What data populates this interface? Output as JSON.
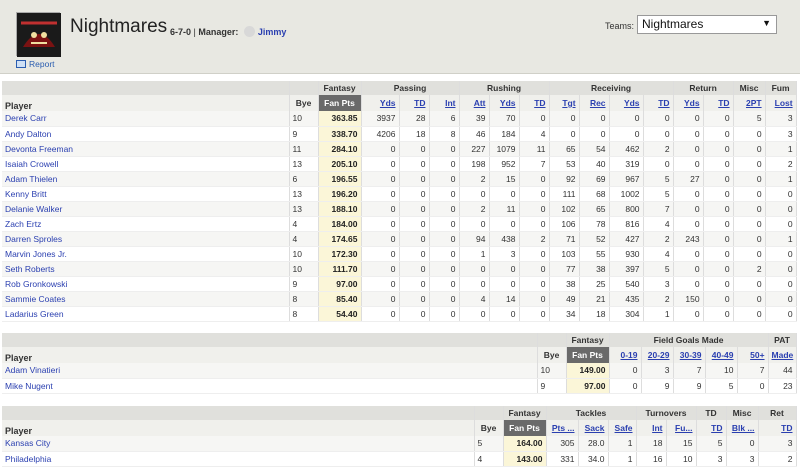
{
  "header": {
    "team_name": "Nightmares",
    "record": "6-7-0",
    "manager_label": "Manager:",
    "manager_name": "Jimmy",
    "report_label": "Report",
    "teams_label": "Teams:",
    "teams_selected": "Nightmares"
  },
  "offense": {
    "groups": {
      "fantasy": "Fantasy",
      "passing": "Passing",
      "rushing": "Rushing",
      "receiving": "Receiving",
      "return": "Return",
      "misc": "Misc",
      "fum": "Fum"
    },
    "cols": {
      "player": "Player",
      "bye": "Bye",
      "fanpts": "Fan Pts",
      "pass_yds": "Yds",
      "pass_td": "TD",
      "int": "Int",
      "att": "Att",
      "rush_yds": "Yds",
      "rush_td": "TD",
      "tgt": "Tgt",
      "rec": "Rec",
      "rec_yds": "Yds",
      "rec_td": "TD",
      "ret_yds": "Yds",
      "ret_td": "TD",
      "two_pt": "2PT",
      "lost": "Lost"
    },
    "rows": [
      {
        "name": "Derek Carr",
        "bye": "10",
        "fan": "363.85",
        "v": [
          "3937",
          "28",
          "6",
          "39",
          "70",
          "0",
          "0",
          "0",
          "0",
          "0",
          "0",
          "0",
          "5",
          "3"
        ]
      },
      {
        "name": "Andy Dalton",
        "bye": "9",
        "fan": "338.70",
        "v": [
          "4206",
          "18",
          "8",
          "46",
          "184",
          "4",
          "0",
          "0",
          "0",
          "0",
          "0",
          "0",
          "0",
          "3"
        ]
      },
      {
        "name": "Devonta Freeman",
        "bye": "11",
        "fan": "284.10",
        "v": [
          "0",
          "0",
          "0",
          "227",
          "1079",
          "11",
          "65",
          "54",
          "462",
          "2",
          "0",
          "0",
          "0",
          "1"
        ]
      },
      {
        "name": "Isaiah Crowell",
        "bye": "13",
        "fan": "205.10",
        "v": [
          "0",
          "0",
          "0",
          "198",
          "952",
          "7",
          "53",
          "40",
          "319",
          "0",
          "0",
          "0",
          "0",
          "2"
        ]
      },
      {
        "name": "Adam Thielen",
        "bye": "6",
        "fan": "196.55",
        "v": [
          "0",
          "0",
          "0",
          "2",
          "15",
          "0",
          "92",
          "69",
          "967",
          "5",
          "27",
          "0",
          "0",
          "1"
        ]
      },
      {
        "name": "Kenny Britt",
        "bye": "13",
        "fan": "196.20",
        "v": [
          "0",
          "0",
          "0",
          "0",
          "0",
          "0",
          "111",
          "68",
          "1002",
          "5",
          "0",
          "0",
          "0",
          "0"
        ]
      },
      {
        "name": "Delanie Walker",
        "bye": "13",
        "fan": "188.10",
        "v": [
          "0",
          "0",
          "0",
          "2",
          "11",
          "0",
          "102",
          "65",
          "800",
          "7",
          "0",
          "0",
          "0",
          "0"
        ]
      },
      {
        "name": "Zach Ertz",
        "bye": "4",
        "fan": "184.00",
        "v": [
          "0",
          "0",
          "0",
          "0",
          "0",
          "0",
          "106",
          "78",
          "816",
          "4",
          "0",
          "0",
          "0",
          "0"
        ]
      },
      {
        "name": "Darren Sproles",
        "bye": "4",
        "fan": "174.65",
        "v": [
          "0",
          "0",
          "0",
          "94",
          "438",
          "2",
          "71",
          "52",
          "427",
          "2",
          "243",
          "0",
          "0",
          "1"
        ]
      },
      {
        "name": "Marvin Jones Jr.",
        "bye": "10",
        "fan": "172.30",
        "v": [
          "0",
          "0",
          "0",
          "1",
          "3",
          "0",
          "103",
          "55",
          "930",
          "4",
          "0",
          "0",
          "0",
          "0"
        ]
      },
      {
        "name": "Seth Roberts",
        "bye": "10",
        "fan": "111.70",
        "v": [
          "0",
          "0",
          "0",
          "0",
          "0",
          "0",
          "77",
          "38",
          "397",
          "5",
          "0",
          "0",
          "2",
          "0"
        ]
      },
      {
        "name": "Rob Gronkowski",
        "bye": "9",
        "fan": "97.00",
        "v": [
          "0",
          "0",
          "0",
          "0",
          "0",
          "0",
          "38",
          "25",
          "540",
          "3",
          "0",
          "0",
          "0",
          "0"
        ]
      },
      {
        "name": "Sammie Coates",
        "bye": "8",
        "fan": "85.40",
        "v": [
          "0",
          "0",
          "0",
          "4",
          "14",
          "0",
          "49",
          "21",
          "435",
          "2",
          "150",
          "0",
          "0",
          "0"
        ]
      },
      {
        "name": "Ladarius Green",
        "bye": "8",
        "fan": "54.40",
        "v": [
          "0",
          "0",
          "0",
          "0",
          "0",
          "0",
          "34",
          "18",
          "304",
          "1",
          "0",
          "0",
          "0",
          "0"
        ]
      }
    ]
  },
  "kickers": {
    "groups": {
      "fantasy": "Fantasy",
      "fgm": "Field Goals Made",
      "pat": "PAT"
    },
    "cols": {
      "player": "Player",
      "bye": "Bye",
      "fanpts": "Fan Pts",
      "r0": "0-19",
      "r20": "20-29",
      "r30": "30-39",
      "r40": "40-49",
      "r50": "50+",
      "made": "Made"
    },
    "rows": [
      {
        "name": "Adam Vinatieri",
        "bye": "10",
        "fan": "149.00",
        "v": [
          "0",
          "3",
          "7",
          "10",
          "7",
          "44"
        ]
      },
      {
        "name": "Mike Nugent",
        "bye": "9",
        "fan": "97.00",
        "v": [
          "0",
          "9",
          "9",
          "5",
          "0",
          "23"
        ]
      }
    ]
  },
  "defense": {
    "groups": {
      "fantasy": "Fantasy",
      "tackles": "Tackles",
      "turnovers": "Turnovers",
      "td": "TD",
      "misc": "Misc",
      "ret": "Ret"
    },
    "cols": {
      "player": "Player",
      "bye": "Bye",
      "fanpts": "Fan Pts",
      "pts": "Pts ...",
      "sack": "Sack",
      "safe": "Safe",
      "int": "Int",
      "fu": "Fu...",
      "td": "TD",
      "blk": "Blk ...",
      "ret_td": "TD"
    },
    "rows": [
      {
        "name": "Kansas City",
        "bye": "5",
        "fan": "164.00",
        "v": [
          "305",
          "28.0",
          "1",
          "18",
          "15",
          "5",
          "0",
          "3"
        ]
      },
      {
        "name": "Philadelphia",
        "bye": "4",
        "fan": "143.00",
        "v": [
          "331",
          "34.0",
          "1",
          "16",
          "10",
          "3",
          "3",
          "2"
        ]
      }
    ]
  }
}
